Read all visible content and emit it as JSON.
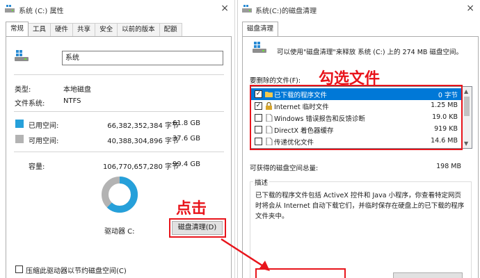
{
  "left_window": {
    "title": "系统 (C:) 属性",
    "close": "×",
    "tabs": [
      "常规",
      "工具",
      "硬件",
      "共享",
      "安全",
      "以前的版本",
      "配额"
    ],
    "drive_name": "系统",
    "type_label": "类型:",
    "type_value": "本地磁盘",
    "fs_label": "文件系统:",
    "fs_value": "NTFS",
    "used": {
      "label": "已用空间:",
      "bytes": "66,382,352,384 字节",
      "size": "61.8 GB",
      "color": "#26a0da"
    },
    "free": {
      "label": "可用空间:",
      "bytes": "40,388,304,896 字节",
      "size": "37.6 GB",
      "color": "#b3b3b3"
    },
    "capacity": {
      "label": "容量:",
      "bytes": "106,770,657,280 字节",
      "size": "99.4 GB"
    },
    "used_fraction": 0.622,
    "drive_label": "驱动器 C:",
    "cleanup_button": "磁盘清理(D)",
    "compress_checkbox": "压缩此驱动器以节约磁盘空间(C)"
  },
  "right_window": {
    "title": "系统(C:)的磁盘清理",
    "close": "×",
    "tab": "磁盘清理",
    "intro": "可以使用\"磁盘清理\"来释放 系统 (C:) 上的 274 MB 磁盘空间。",
    "files_label": "要删除的文件(F):",
    "files": [
      {
        "name": "已下载的程序文件",
        "size": "0 字节",
        "checked": true,
        "selected": true,
        "icon": "folder-icon"
      },
      {
        "name": "Internet 临时文件",
        "size": "1.25 MB",
        "checked": true,
        "selected": false,
        "icon": "lock-icon"
      },
      {
        "name": "Windows 错误报告和反馈诊断",
        "size": "19.0 KB",
        "checked": false,
        "selected": false,
        "icon": "file-icon"
      },
      {
        "name": "DirectX 着色器缓存",
        "size": "919 KB",
        "checked": false,
        "selected": false,
        "icon": "file-icon"
      },
      {
        "name": "传递优化文件",
        "size": "14.6 MB",
        "checked": false,
        "selected": false,
        "icon": "file-icon"
      }
    ],
    "total_label": "可获得的磁盘空间总量:",
    "total_value": "198 MB",
    "desc_title": "描述",
    "desc_text": "已下载的程序文件包括 ActiveX 控件和 Java 小程序，你查看特定网页时将会从 Internet 自动下载它们，并临时保存在硬盘上的已下载的程序文件夹中。"
  },
  "annotations": {
    "select_files": "勾选文件",
    "click": "点击",
    "color": "#e8141b"
  }
}
